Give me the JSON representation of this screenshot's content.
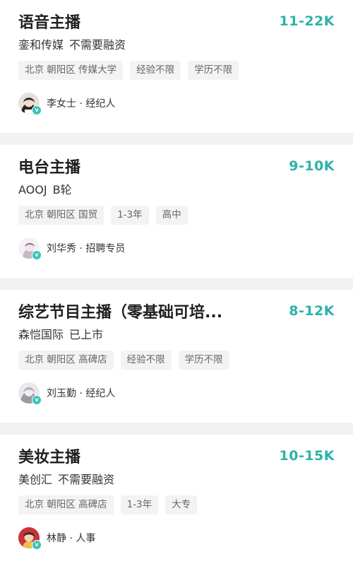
{
  "jobs": [
    {
      "title": "语音主播",
      "salary": "11-22K",
      "company": "銮和传媒",
      "funding": "不需要融资",
      "tags": [
        "北京 朝阳区 传媒大学",
        "经验不限",
        "学历不限"
      ],
      "recruiter": "李女士 · 经纪人"
    },
    {
      "title": "电台主播",
      "salary": "9-10K",
      "company": "AOOJ",
      "funding": "B轮",
      "tags": [
        "北京 朝阳区 国贸",
        "1-3年",
        "高中"
      ],
      "recruiter": "刘华秀 · 招聘专员"
    },
    {
      "title": "综艺节目主播（零基础可培...",
      "salary": "8-12K",
      "company": "森恺国际",
      "funding": "已上市",
      "tags": [
        "北京 朝阳区 高碑店",
        "经验不限",
        "学历不限"
      ],
      "recruiter": "刘玉勤 · 经纪人"
    },
    {
      "title": "美妆主播",
      "salary": "10-15K",
      "company": "美创汇",
      "funding": "不需要融资",
      "tags": [
        "北京 朝阳区 高碑店",
        "1-3年",
        "大专"
      ],
      "recruiter": "林静 · 人事"
    }
  ],
  "colors": {
    "salary": "#2bb3a9",
    "badge": "#3cc3b6",
    "tag_bg": "#f3f3f3"
  },
  "icons": {
    "verified_badge": "v"
  }
}
